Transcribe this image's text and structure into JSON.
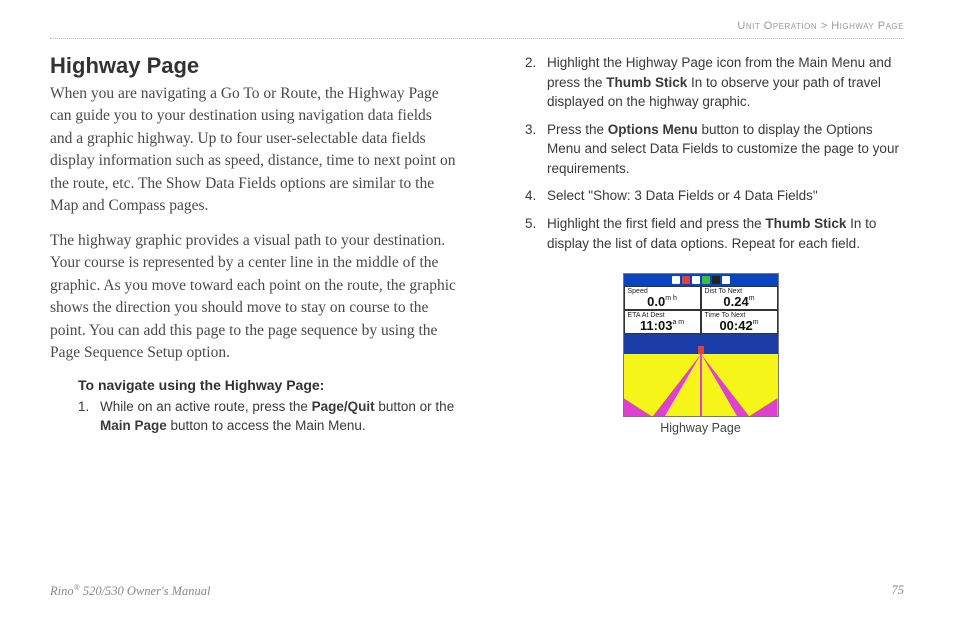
{
  "breadcrumb": {
    "section": "Unit Operation",
    "sep": " > ",
    "page": "Highway Page"
  },
  "title": "Highway Page",
  "para1": "When you are navigating a Go To or Route, the Highway Page can guide you to your destination using navigation data fields and a graphic highway. Up to four user-selectable data fields display information such as speed, distance, time to next point on the route, etc. The Show Data Fields options are similar to the Map  and Compass pages.",
  "para2": "The highway graphic provides a visual path to your destination. Your course is represented by a center line in the middle of the graphic. As you move toward each point on the route, the graphic shows the direction you should move to stay on course to the point. You can add this page to the page sequence by using the Page Sequence Setup option.",
  "subhead": "To navigate using the Highway Page:",
  "steps": [
    {
      "n": "1.",
      "pre": "While on an active route, press the ",
      "b1": "Page/Quit",
      "mid": " button or the ",
      "b2": "Main Page",
      "post": " button to access the Main Menu."
    },
    {
      "n": "2.",
      "pre": "Highlight the Highway Page icon from the Main Menu and press the ",
      "b1": "Thumb Stick",
      "mid": " In to observe your path of travel displayed on the highway graphic.",
      "b2": "",
      "post": ""
    },
    {
      "n": "3.",
      "pre": "Press the ",
      "b1": "Options Menu",
      "mid": " button to display the Options Menu and select Data Fields to customize the page to your requirements.",
      "b2": "",
      "post": ""
    },
    {
      "n": "4.",
      "pre": "Select \"Show: 3 Data Fields or 4 Data Fields\"",
      "b1": "",
      "mid": "",
      "b2": "",
      "post": ""
    },
    {
      "n": "5.",
      "pre": "Highlight the first field and press the ",
      "b1": "Thumb Stick",
      "mid": " In to display the list of data options. Repeat for each field.",
      "b2": "",
      "post": ""
    }
  ],
  "device": {
    "fields": [
      {
        "label": "Speed",
        "value": "0.0",
        "unit": "m h"
      },
      {
        "label": "Dist To Next",
        "value": "0.24",
        "unit": "m"
      },
      {
        "label": "ETA At Dest",
        "value": "11:03",
        "unit": "a m"
      },
      {
        "label": "Time To Next",
        "value": "00:42",
        "unit": "m"
      }
    ]
  },
  "caption": "Highway Page",
  "footer": {
    "manual_pre": "Rino",
    "manual_sup": "®",
    "manual_post": " 520/530 Owner's Manual",
    "pagenum": "75"
  }
}
